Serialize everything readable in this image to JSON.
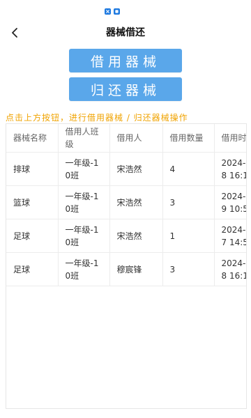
{
  "header": {
    "title": "器械借还"
  },
  "buttons": {
    "borrow_label": "借用器械",
    "return_label": "归还器械"
  },
  "hint": "点击上方按钮，进行借用器械 / 归还器械操作",
  "table": {
    "headers": [
      "器械名称",
      "借用人班级",
      "借用人",
      "借用数量",
      "借用时"
    ],
    "rows": [
      {
        "name": "排球",
        "class": "一年级-10班",
        "person": "宋浩然",
        "qty": "4",
        "time": "2024-\n8 16:1"
      },
      {
        "name": "篮球",
        "class": "一年级-10班",
        "person": "宋浩然",
        "qty": "3",
        "time": "2024-\n9 10:5"
      },
      {
        "name": "足球",
        "class": "一年级-10班",
        "person": "宋浩然",
        "qty": "1",
        "time": "2024-\n7 14:5"
      },
      {
        "name": "足球",
        "class": "一年级-10班",
        "person": "穆宸锋",
        "qty": "3",
        "time": "2024-\n8 16:1"
      }
    ]
  },
  "colors": {
    "button_bg": "#5aa7ea",
    "hint_color": "#f0a300",
    "status_icon": "#1f7ae0"
  },
  "icons": {
    "back": "chevron-left-icon"
  }
}
